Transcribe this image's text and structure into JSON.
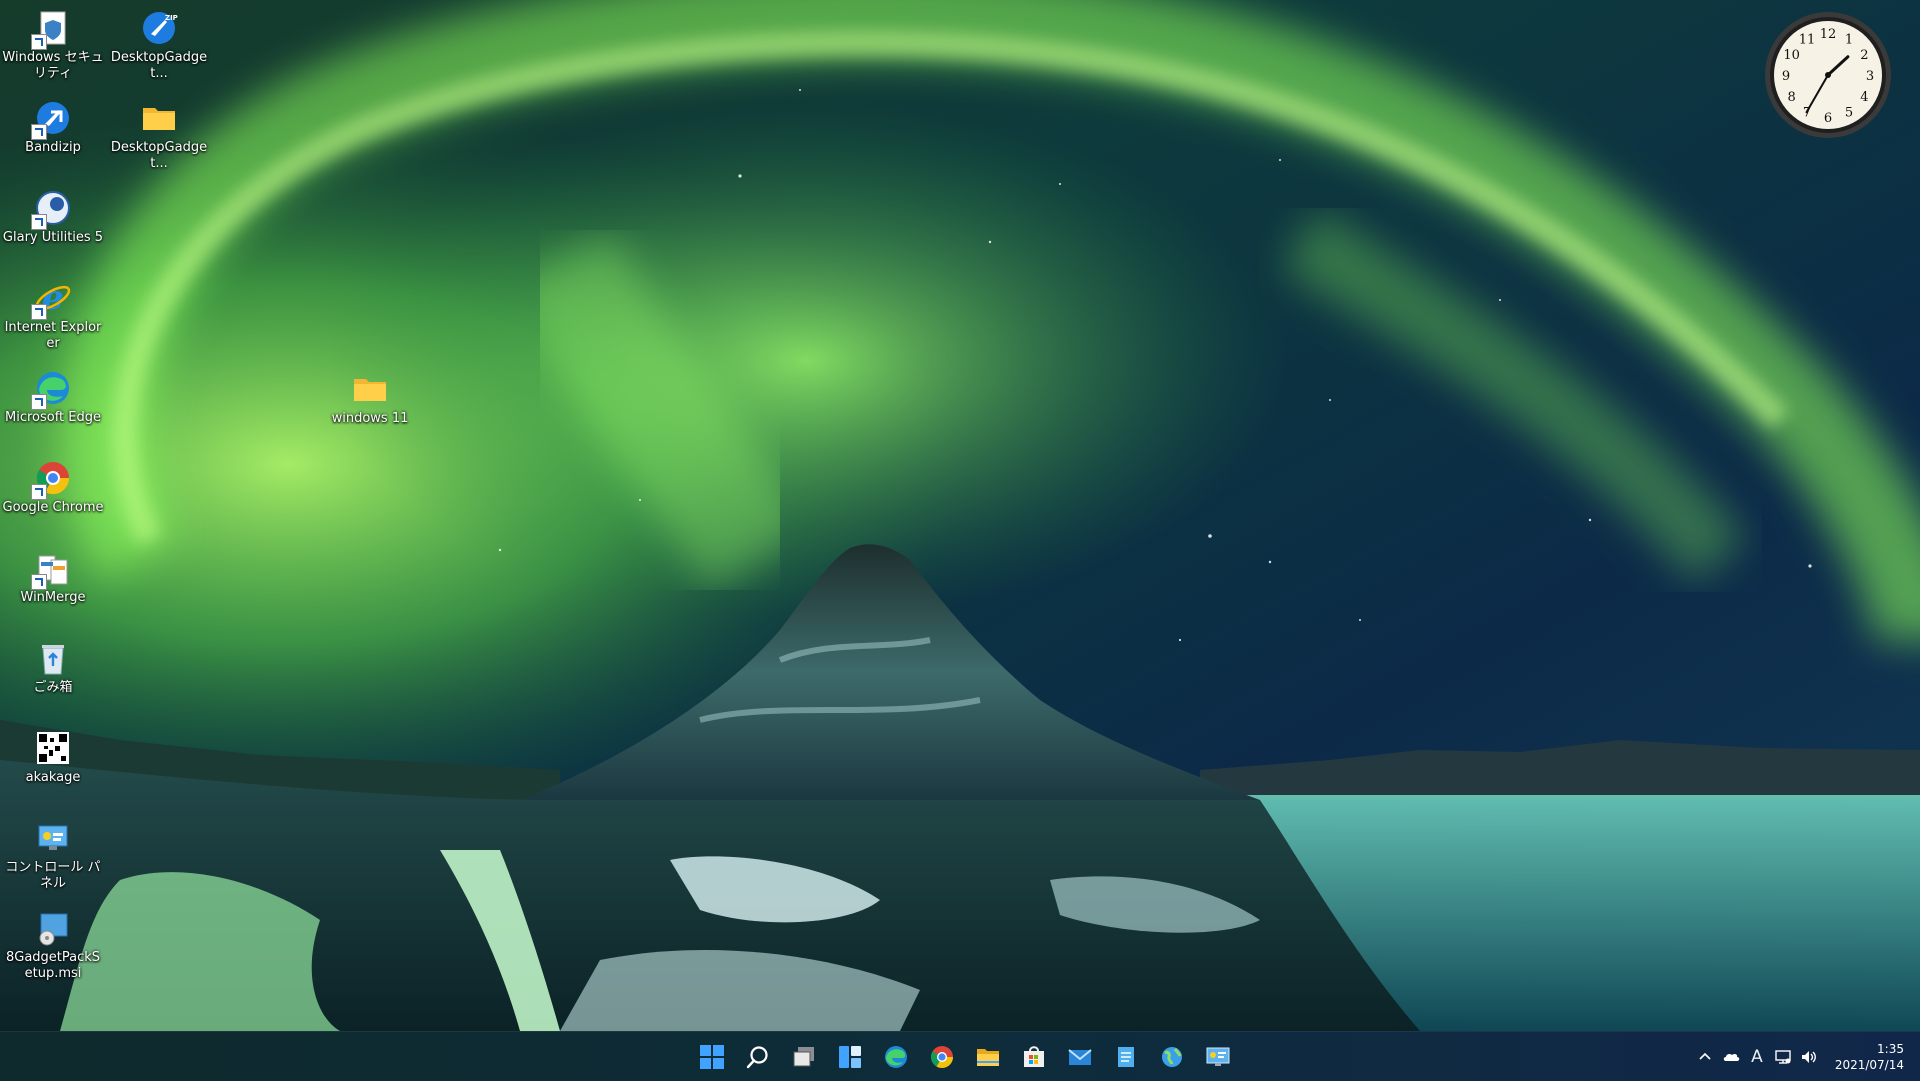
{
  "desktop": {
    "icons": [
      {
        "label": "Windows セキュリティ",
        "icon": "shield-file-icon"
      },
      {
        "label": "DesktopGadget...",
        "icon": "bandizip-zip-icon"
      },
      {
        "label": "Bandizip",
        "icon": "bandizip-icon"
      },
      {
        "label": "DesktopGadget...",
        "icon": "folder-icon"
      },
      {
        "label": "Glary Utilities 5",
        "icon": "glary-utilities-icon"
      },
      {
        "label": "Internet Explorer",
        "icon": "internet-explorer-icon"
      },
      {
        "label": "Microsoft Edge",
        "icon": "edge-icon"
      },
      {
        "label": "Google Chrome",
        "icon": "chrome-icon"
      },
      {
        "label": "WinMerge",
        "icon": "winmerge-icon"
      },
      {
        "label": "ごみ箱",
        "icon": "recycle-bin-icon"
      },
      {
        "label": "akakage",
        "icon": "qr-image-icon"
      },
      {
        "label": "コントロール パネル",
        "icon": "control-panel-icon"
      },
      {
        "label": "8GadgetPackSetup.msi",
        "icon": "msi-installer-icon"
      },
      {
        "label": "windows 11",
        "icon": "folder-icon"
      }
    ]
  },
  "clock_gadget": {
    "numerals": [
      "12",
      "1",
      "2",
      "3",
      "4",
      "5",
      "6",
      "7",
      "8",
      "9",
      "10",
      "11"
    ],
    "time": "1:35"
  },
  "taskbar": {
    "apps": [
      {
        "name": "Start",
        "icon": "windows-start-icon"
      },
      {
        "name": "Search",
        "icon": "search-icon"
      },
      {
        "name": "Task View",
        "icon": "task-view-icon"
      },
      {
        "name": "Widgets",
        "icon": "widgets-icon"
      },
      {
        "name": "Microsoft Edge",
        "icon": "edge-icon"
      },
      {
        "name": "Google Chrome",
        "icon": "chrome-icon"
      },
      {
        "name": "File Explorer",
        "icon": "file-explorer-icon"
      },
      {
        "name": "Microsoft Store",
        "icon": "store-icon"
      },
      {
        "name": "Mail",
        "icon": "mail-icon"
      },
      {
        "name": "Notepad",
        "icon": "notepad-icon"
      },
      {
        "name": "Globe App",
        "icon": "globe-icon"
      },
      {
        "name": "Control Panel",
        "icon": "control-panel-icon"
      }
    ],
    "tray": {
      "ime": "A",
      "time": "1:35",
      "date": "2021/07/14"
    }
  },
  "colors": {
    "aurora": "#7cf04a",
    "sky": "#0b2a45",
    "taskbar": "#0e2c3a",
    "accent": "#3fa3ff"
  }
}
